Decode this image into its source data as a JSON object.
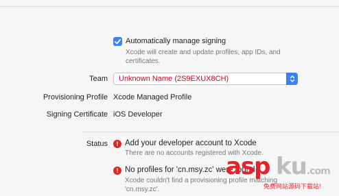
{
  "signing": {
    "auto_manage_label": "Automatically manage signing",
    "auto_manage_checked": true,
    "auto_manage_description_line1": "Xcode will create and update profiles, app IDs, and",
    "auto_manage_description_line2": "certificates."
  },
  "team": {
    "label": "Team",
    "value": "Unknown Name (2S9EXUX8CH)"
  },
  "provisioning_profile": {
    "label": "Provisioning Profile",
    "value": "Xcode Managed Profile"
  },
  "signing_certificate": {
    "label": "Signing Certificate",
    "value": "iOS Developer"
  },
  "status": {
    "label": "Status",
    "messages": [
      {
        "title": "Add your developer account to Xcode",
        "detail": "There are no accounts registered with Xcode."
      },
      {
        "title": "No profiles for 'cn.msy.zc' were found",
        "detail_line1": "Xcode couldn't find a provisioning profile matching",
        "detail_line2": "'cn.msy.zc'."
      }
    ]
  },
  "watermark": {
    "brand_red": "asp",
    "brand_gray": "ku",
    "suffix": ".com",
    "tagline": "免费网站源码下载站!"
  },
  "colors": {
    "accent": "#3b82f6",
    "error": "#d9281e",
    "team_text": "#d0021b"
  }
}
